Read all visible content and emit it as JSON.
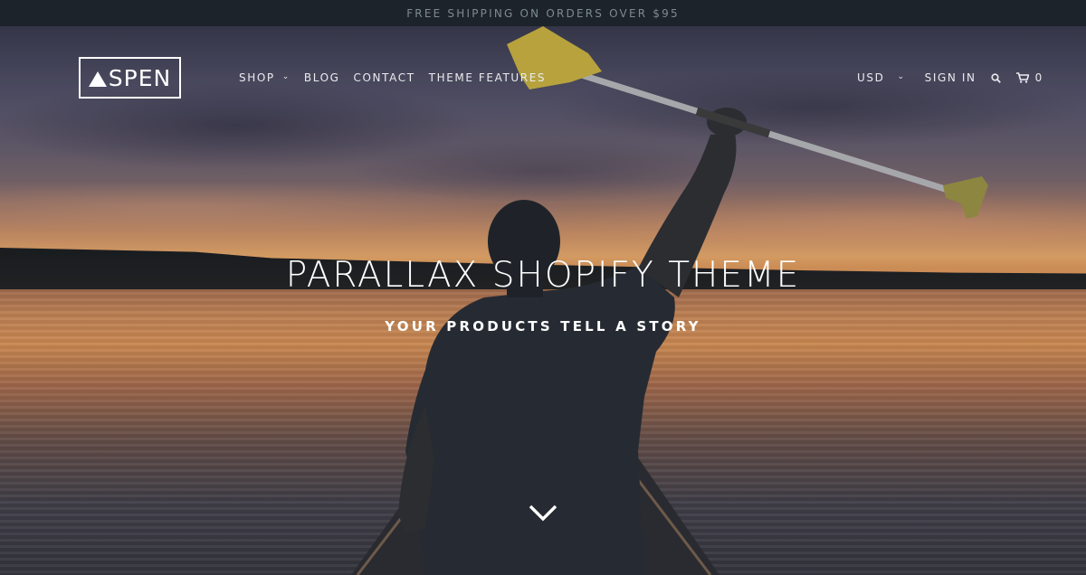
{
  "announcement": "FREE SHIPPING ON ORDERS OVER $95",
  "header": {
    "logo_text": "SPEN",
    "nav": [
      {
        "label": "SHOP",
        "has_dropdown": true
      },
      {
        "label": "BLOG"
      },
      {
        "label": "CONTACT"
      },
      {
        "label": "THEME FEATURES"
      }
    ],
    "currency": "USD",
    "sign_in": "SIGN IN",
    "search_icon": "search-icon",
    "cart_icon": "cart-icon",
    "cart_count": "0"
  },
  "hero": {
    "title": "PARALLAX SHOPIFY THEME",
    "subtitle": "YOUR PRODUCTS TELL A STORY",
    "scroll_icon": "chevron-down-icon"
  },
  "colors": {
    "announcement_bg": "#1d232a",
    "announcement_text": "#7d8a93",
    "text": "#ffffff"
  }
}
